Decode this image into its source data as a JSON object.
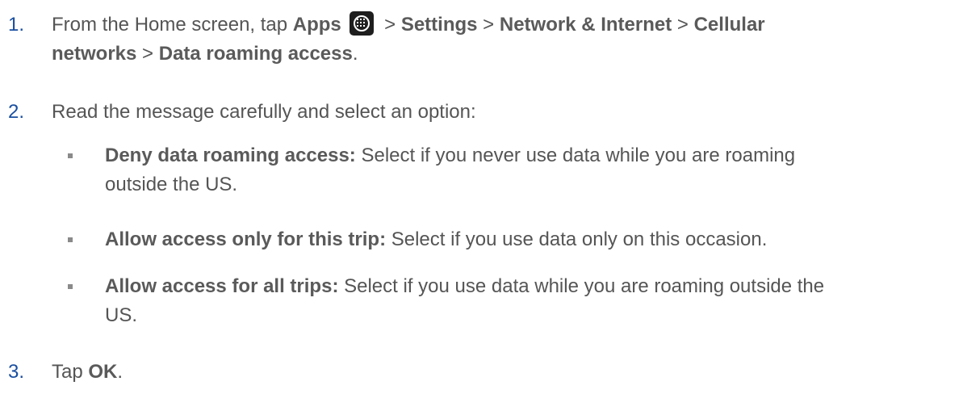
{
  "steps": [
    {
      "number": "1.",
      "parts": {
        "p1": "From the Home screen, tap ",
        "apps": "Apps",
        "sep1": " > ",
        "settings": "Settings",
        "sep2": " > ",
        "network": "Network & Internet",
        "sep3": " > ",
        "cellular": "Cellular",
        "cellular2": "networks",
        "sep4": " > ",
        "roaming": "Data roaming access",
        "end": "."
      },
      "icon": "apps-grid-icon"
    },
    {
      "number": "2.",
      "text": "Read the message carefully and select an option:"
    },
    {
      "number": "3.",
      "prefix": "Tap ",
      "bold": "OK",
      "suffix": "."
    }
  ],
  "options": [
    {
      "label": "Deny data roaming access:",
      "line1": " Select if you never use data while you are roaming",
      "line2": "outside the US."
    },
    {
      "label": "Allow access only for this trip:",
      "line1": " Select if you use data only on this occasion.",
      "line2": ""
    },
    {
      "label": "Allow access for all trips:",
      "line1": " Select if you use data while you are roaming outside the",
      "line2": "US."
    }
  ],
  "colors": {
    "number": "#1a4fa0",
    "text": "#555555",
    "bullet": "#8a8a8a"
  }
}
